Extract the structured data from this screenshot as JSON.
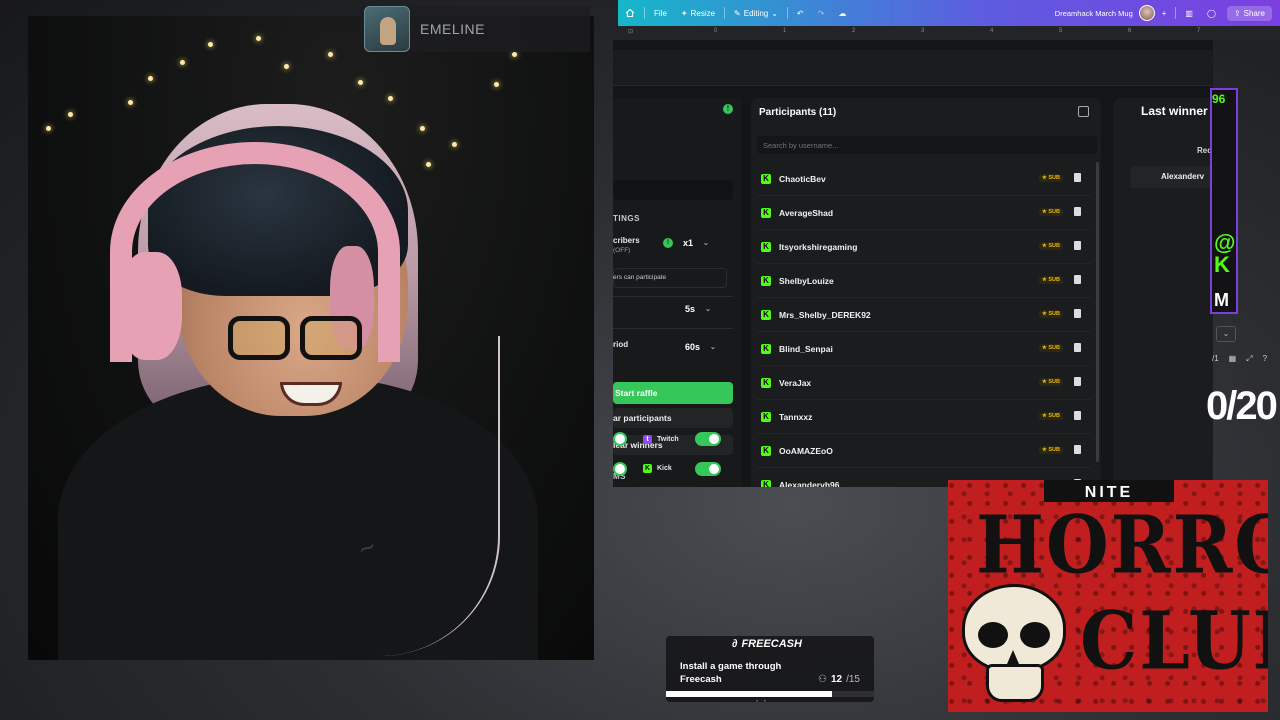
{
  "overlay": {
    "viewer_name": "EMELINE"
  },
  "editor": {
    "home_icon": "home-icon",
    "file": "File",
    "resize": "Resize",
    "editing": "Editing",
    "design_title": "Dreamhack March Mug",
    "share": "Share",
    "ruler_ticks": [
      "0",
      "1",
      "2",
      "3",
      "4",
      "5",
      "6",
      "7"
    ]
  },
  "settings": {
    "heading": "TINGS",
    "subscribers_label": "cribers",
    "subscribers_sub": "(OFF)",
    "multiplier": "x1",
    "who_can_participate": "ers can participate",
    "delay_value": "5s",
    "period_label": "riod",
    "period_value": "60s",
    "start_raffle": "Start raffle",
    "clear_participants": "ar participants",
    "clear_winners": "lear winners",
    "platforms_heading": "MS",
    "platforms": [
      {
        "name": "Twitch",
        "enabled": true,
        "color": "#9146ff"
      },
      {
        "name": "Kick",
        "enabled": true,
        "color": "#53fc18"
      }
    ]
  },
  "participants": {
    "title": "Participants (11)",
    "search_placeholder": "Search by username...",
    "badge": "SUB",
    "list": [
      "ChaoticBev",
      "AverageShad",
      "Itsyorkshiregaming",
      "ShelbyLouize",
      "Mrs_Shelby_DEREK92",
      "Blind_Senpai",
      "VeraJax",
      "Tannxxz",
      "OoAMAZEoO",
      "Alexandervh96"
    ]
  },
  "winners": {
    "title": "Last winner",
    "sub_label": "Rec",
    "winner_name": "Alexanderv"
  },
  "side_fragments": {
    "number": "96",
    "kick_partial": "@\nK",
    "m_partial": "M",
    "page_indicator": "/1",
    "counter": "0/20"
  },
  "horror_logo": {
    "top_text": "NITE",
    "line1": "HORROR",
    "line2": "CLUB"
  },
  "freecash": {
    "brand": "FREECASH",
    "task": "Install a game through Freecash",
    "progress_current": "12",
    "progress_total": "/15",
    "progress_fraction": 0.8
  }
}
